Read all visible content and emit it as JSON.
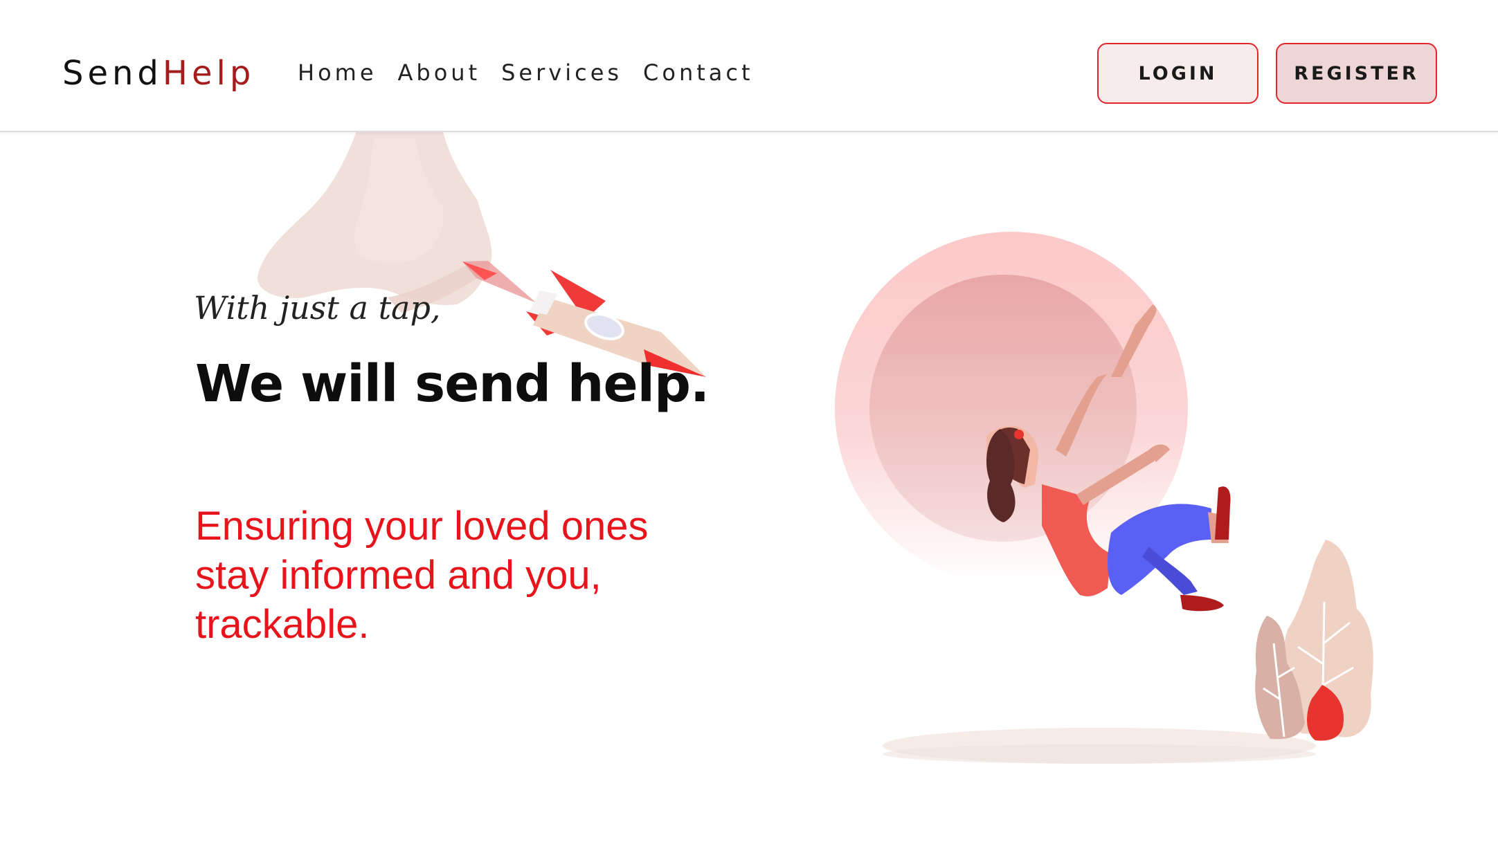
{
  "brand": {
    "name_part1": "Send",
    "name_part2": "Help",
    "accent_color": "#a51c1c"
  },
  "nav": {
    "items": [
      {
        "label": "Home"
      },
      {
        "label": "About"
      },
      {
        "label": "Services"
      },
      {
        "label": "Contact"
      }
    ]
  },
  "auth": {
    "login_label": "LOGIN",
    "register_label": "REGISTER",
    "border_color": "#e0262d"
  },
  "hero": {
    "tagline": "With just a tap,",
    "headline": "We will send help.",
    "subtext": "Ensuring your loved ones stay informed and you, trackable.",
    "subtext_color": "#e8141c"
  },
  "illustrations": {
    "rocket": "rocket-icon",
    "person": "falling-person-illustration",
    "plants": "plant-leaves-illustration"
  }
}
